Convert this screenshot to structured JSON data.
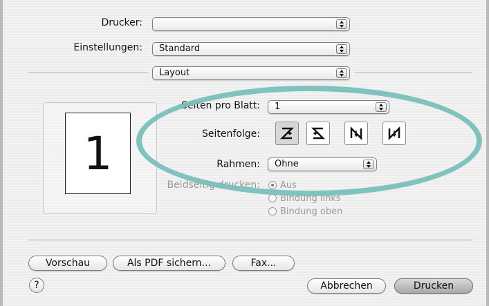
{
  "printer": {
    "label": "Drucker:",
    "value": ""
  },
  "settings": {
    "label": "Einstellungen:",
    "value": "Standard"
  },
  "panel": {
    "value": "Layout"
  },
  "layout": {
    "pages_per_sheet": {
      "label": "Seiten pro Blatt:",
      "value": "1"
    },
    "page_order": {
      "label": "Seitenfolge:",
      "options": [
        "z-order-icon",
        "reverse-z-order-icon",
        "n-order-icon",
        "reverse-n-order-icon"
      ],
      "selected_index": 0
    },
    "border": {
      "label": "Rahmen:",
      "value": "Ohne"
    },
    "duplex": {
      "label": "Beidseitig drucken:",
      "options": [
        "Aus",
        "Bindung links",
        "Bindung oben"
      ],
      "selected_index": 0
    },
    "preview_page_number": "1"
  },
  "buttons": {
    "preview": "Vorschau",
    "save_pdf": "Als PDF sichern...",
    "fax": "Fax...",
    "cancel": "Abbrechen",
    "print": "Drucken",
    "help": "?"
  },
  "colors": {
    "highlight_ring": "#76beba"
  }
}
